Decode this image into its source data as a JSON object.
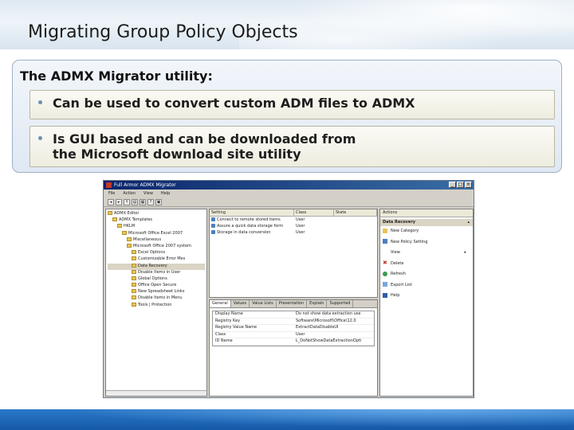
{
  "slide": {
    "title": "Migrating Group Policy Objects",
    "heading": "The ADMX Migrator utility:",
    "bullets": [
      {
        "text": "Can be used to convert custom ADM files to ADMX"
      },
      {
        "line1": "Is GUI based and can be downloaded from",
        "line2": "the Microsoft download site utility"
      }
    ]
  },
  "colors": {
    "title_bar_gradient_start": "#0a246a",
    "footer_blue": "#1559a8",
    "bullet_dot": "#6d8fb8"
  },
  "screenshot": {
    "window_title": "Full Armor ADMX Migrator",
    "window_buttons": [
      "_",
      "□",
      "×"
    ],
    "menu": [
      "File",
      "Action",
      "View",
      "Help"
    ],
    "toolbar_icons": [
      "back-icon",
      "forward-icon",
      "up-icon",
      "show-hide-tree-icon",
      "properties-icon",
      "help-icon",
      "view-icon"
    ],
    "tree": [
      "ADMX Editor",
      "ADMX Templates",
      "HKLM",
      "Microsoft Office Excel 2007",
      "Miscellaneous",
      "Microsoft Office 2007 system",
      "Excel Options",
      "Customizable Error Mes",
      "Data Recovery",
      "Disable Items in User",
      "Global Options",
      "Office Open Secure",
      "New Spreadsheet Links",
      "Disable Items in Menu",
      "Tools | Protection"
    ],
    "list": {
      "headers": [
        "Setting",
        "Class",
        "State"
      ],
      "rows": [
        [
          "Connect to remote stored items",
          "User",
          ""
        ],
        [
          "Assure a quick data storage form",
          "User",
          ""
        ],
        [
          "Storage in data conversion",
          "User",
          ""
        ]
      ]
    },
    "prop_tabs": [
      "General",
      "Values",
      "Value Lists",
      "Presentation",
      "Explain",
      "Supported"
    ],
    "props": [
      [
        "Display Name",
        "Do not show data extraction use"
      ],
      [
        "Registry Key",
        "Software\\Microsoft\\Office\\12.0"
      ],
      [
        "Registry Value Name",
        "ExtractDataDisableUI"
      ],
      [
        "Class",
        "User"
      ],
      [
        "ID Name",
        "L_DoNotShowDataExtractionOpti"
      ]
    ],
    "actions": {
      "header": "Actions",
      "section": "Data Recovery",
      "items": [
        "New Category",
        "New Policy Setting",
        "View",
        "Delete",
        "Refresh",
        "Export List",
        "Help"
      ]
    }
  }
}
